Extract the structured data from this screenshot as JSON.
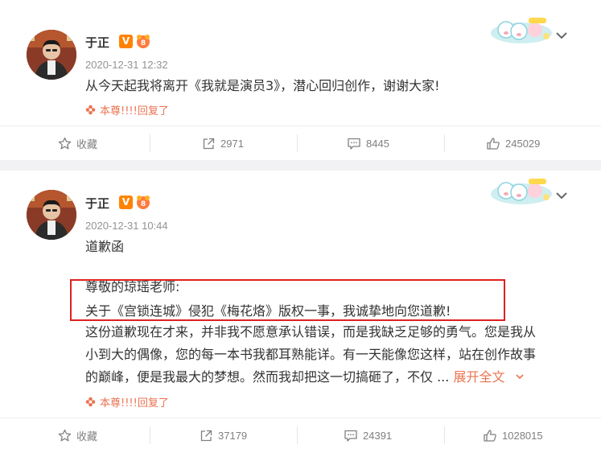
{
  "posts": [
    {
      "author": "于正",
      "verified_badge": "V",
      "time": "2020-12-31 12:32",
      "text_lines": [
        "从今天起我将离开《我就是演员3》，潜心回归创作，谢谢大家!"
      ],
      "source": "本尊!!!!回复了",
      "actions": {
        "favorite": "收藏",
        "repost": "2971",
        "comment": "8445",
        "like": "245029"
      }
    },
    {
      "author": "于正",
      "verified_badge": "V",
      "time": "2020-12-31 10:44",
      "text_lines": [
        "道歉函",
        "",
        "尊敬的琼瑶老师:",
        "关于《宫锁连城》侵犯《梅花烙》版权一事，我诚挚地向您道歉!",
        "这份道歉现在才来，并非我不愿意承认错误，而是我缺乏足够的勇气。您是我从",
        "小到大的偶像，您的每一本书我都耳熟能详。有一天能像您这样，站在创作故事",
        "的巅峰，便是我最大的梦想。然而我却把这一切搞砸了，不仅 ..."
      ],
      "expand_label": "展开全文",
      "source": "本尊!!!!回复了",
      "actions": {
        "favorite": "收藏",
        "repost": "37179",
        "comment": "24391",
        "like": "1028015"
      }
    }
  ],
  "icons": {
    "favorite": "star-icon",
    "repost": "share-icon",
    "comment": "comment-icon",
    "like": "thumbs-up-icon",
    "menu": "chevron-down-icon"
  },
  "colors": {
    "accent": "#eb7350",
    "badge": "#ff8200",
    "highlight_border": "#e02020"
  }
}
